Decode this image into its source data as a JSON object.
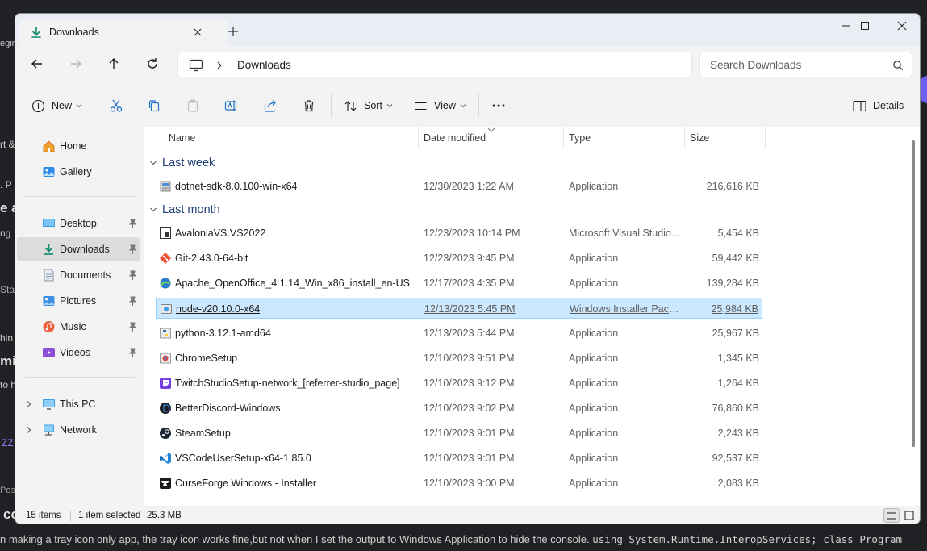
{
  "background": {
    "fragments": [
      "egin",
      "rt &",
      ". P",
      "e a",
      "ng",
      "Sta",
      "hin",
      "mi",
      "to h",
      "ZZ",
      "Pos",
      "co"
    ],
    "bottom_text": "n making a tray icon only app, the tray icon works fine,but not when I set the output to Windows Application to hide the console.",
    "bottom_code": "using System.Runtime.InteropServices; class Program"
  },
  "window": {
    "tab": {
      "label": "Downloads",
      "icon": "download-arrow-icon",
      "close": "close-icon"
    },
    "new_tab_icon": "plus-icon",
    "controls": [
      "minimize-icon",
      "maximize-icon",
      "close-icon"
    ]
  },
  "address": {
    "location_icon": "this-pc-icon",
    "breadcrumb": "Downloads",
    "search_placeholder": "Search Downloads"
  },
  "toolbar": {
    "new_label": "New",
    "sort_label": "Sort",
    "view_label": "View",
    "details_label": "Details"
  },
  "sidebar": {
    "home": "Home",
    "gallery": "Gallery",
    "desktop": "Desktop",
    "downloads": "Downloads",
    "documents": "Documents",
    "pictures": "Pictures",
    "music": "Music",
    "videos": "Videos",
    "this_pc": "This PC",
    "network": "Network"
  },
  "columns": {
    "name": "Name",
    "date": "Date modified",
    "type": "Type",
    "size": "Size"
  },
  "groups": [
    {
      "label": "Last week",
      "files": [
        {
          "name": "dotnet-sdk-8.0.100-win-x64",
          "date": "12/30/2023 1:22 AM",
          "type": "Application",
          "size": "216,616 KB",
          "icon": "installer-icon"
        }
      ]
    },
    {
      "label": "Last month",
      "files": [
        {
          "name": "AvaloniaVS.VS2022",
          "date": "12/23/2023 10:14 PM",
          "type": "Microsoft Visual Studio ...",
          "size": "5,454 KB",
          "icon": "vsix-icon"
        },
        {
          "name": "Git-2.43.0-64-bit",
          "date": "12/23/2023 9:45 PM",
          "type": "Application",
          "size": "59,442 KB",
          "icon": "git-icon"
        },
        {
          "name": "Apache_OpenOffice_4.1.14_Win_x86_install_en-US",
          "date": "12/17/2023 4:35 PM",
          "type": "Application",
          "size": "139,284 KB",
          "icon": "openoffice-icon"
        },
        {
          "name": "node-v20.10.0-x64",
          "date": "12/13/2023 5:45 PM",
          "type": "Windows Installer Packa...",
          "size": "25,984 KB",
          "icon": "msi-icon",
          "selected": true
        },
        {
          "name": "python-3.12.1-amd64",
          "date": "12/13/2023 5:44 PM",
          "type": "Application",
          "size": "25,967 KB",
          "icon": "python-icon"
        },
        {
          "name": "ChromeSetup",
          "date": "12/10/2023 9:51 PM",
          "type": "Application",
          "size": "1,345 KB",
          "icon": "chrome-icon"
        },
        {
          "name": "TwitchStudioSetup-network_[referrer-studio_page]",
          "date": "12/10/2023 9:12 PM",
          "type": "Application",
          "size": "1,264 KB",
          "icon": "twitch-icon"
        },
        {
          "name": "BetterDiscord-Windows",
          "date": "12/10/2023 9:02 PM",
          "type": "Application",
          "size": "76,860 KB",
          "icon": "betterdiscord-icon"
        },
        {
          "name": "SteamSetup",
          "date": "12/10/2023 9:01 PM",
          "type": "Application",
          "size": "2,243 KB",
          "icon": "steam-icon"
        },
        {
          "name": "VSCodeUserSetup-x64-1.85.0",
          "date": "12/10/2023 9:01 PM",
          "type": "Application",
          "size": "92,537 KB",
          "icon": "vscode-icon"
        },
        {
          "name": "CurseForge Windows - Installer",
          "date": "12/10/2023 9:00 PM",
          "type": "Application",
          "size": "2,083 KB",
          "icon": "curseforge-icon"
        }
      ]
    }
  ],
  "status": {
    "items": "15 items",
    "selected": "1 item selected",
    "size": "25.3 MB"
  },
  "colors": {
    "accent": "#0067c0",
    "selection": "#cce8ff",
    "group": "#1f3f7a"
  }
}
